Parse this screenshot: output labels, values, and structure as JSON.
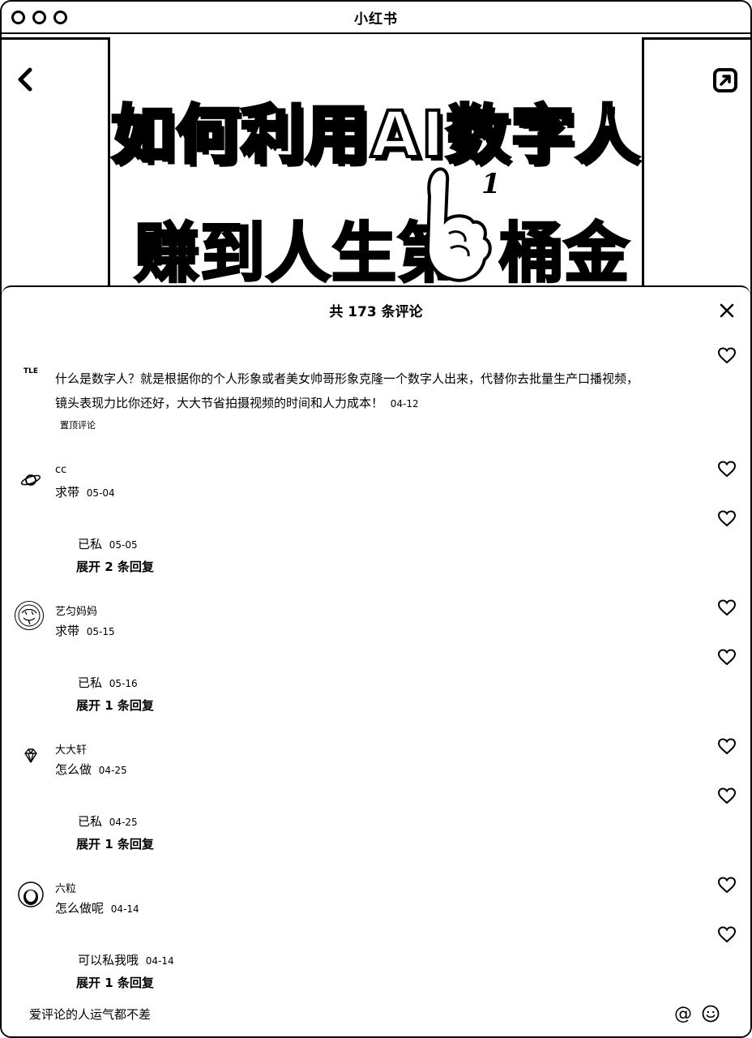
{
  "window": {
    "title": "小红书"
  },
  "cover": {
    "headline_line1": "如何利用AI数字人",
    "headline_line2_left": "赚到人生第",
    "headline_line2_right": "桶金",
    "hand_number": "1"
  },
  "sheet": {
    "header": "共 173 条评论",
    "comments": [
      {
        "name": "",
        "avatar_text": "TLE",
        "text_line1": "什么是数字人？就是根据你的个人形象或者美女帅哥形象克隆一个数字人出来，代替你去批量生产口播视频，",
        "text_line2": "镜头表现力比你还好，大大节省拍摄视频的时间和人力成本！",
        "date": "04-12",
        "tag": "置顶评论"
      },
      {
        "name": "cc",
        "text": "求带",
        "date": "05-04",
        "reply_text": "已私",
        "reply_date": "05-05",
        "expand": "展开 2 条回复"
      },
      {
        "name": "艺匀妈妈",
        "text": "求带",
        "date": "05-15",
        "reply_text": "已私",
        "reply_date": "05-16",
        "expand": "展开 1 条回复"
      },
      {
        "name": "大大轩",
        "text": "怎么做",
        "date": "04-25",
        "reply_text": "已私",
        "reply_date": "04-25",
        "expand": "展开 1 条回复"
      },
      {
        "name": "六粒",
        "text": "怎么做呢",
        "date": "04-14",
        "reply_text": "可以私我哦",
        "reply_date": "04-14",
        "expand": "展开 1 条回复"
      }
    ]
  },
  "input": {
    "placeholder": "爱评论的人运气都不差",
    "at_label": "@"
  },
  "icons": {
    "back": "chevron-left-icon",
    "share": "share-icon",
    "close": "close-icon",
    "heart": "heart-icon",
    "emoji": "smile-icon"
  }
}
